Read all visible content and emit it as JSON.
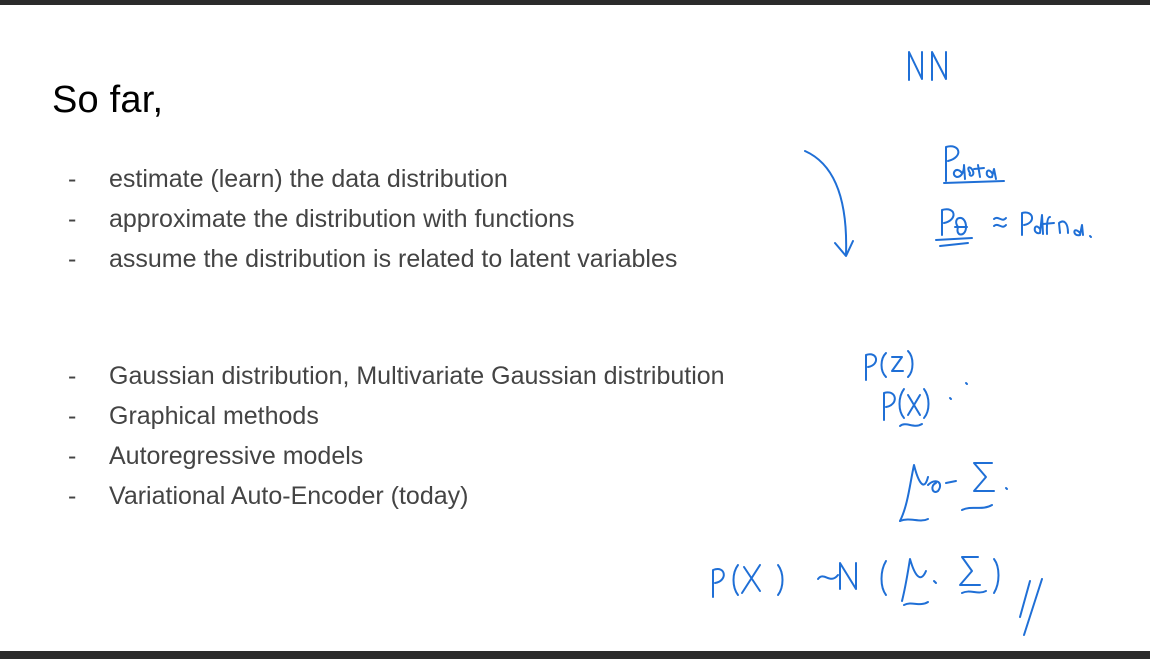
{
  "slide": {
    "title": "So far,",
    "bullet_marker": "-",
    "list_one": [
      "estimate (learn) the data distribution",
      "approximate the distribution with functions",
      "assume the distribution is related to latent variables"
    ],
    "list_two": [
      "Gaussian distribution, Multivariate Gaussian distribution",
      "Graphical methods",
      "Autoregressive models",
      "Variational Auto-Encoder (today)"
    ]
  },
  "handwriting": {
    "ink_color": "#1f6fd6",
    "notes": [
      "NN",
      "Pdata",
      "Pθ ≈ Pdata.",
      "P(z)",
      "P(x)",
      "μ, Σ.",
      "P(X) ~N (μ, Σ)",
      "//"
    ]
  }
}
